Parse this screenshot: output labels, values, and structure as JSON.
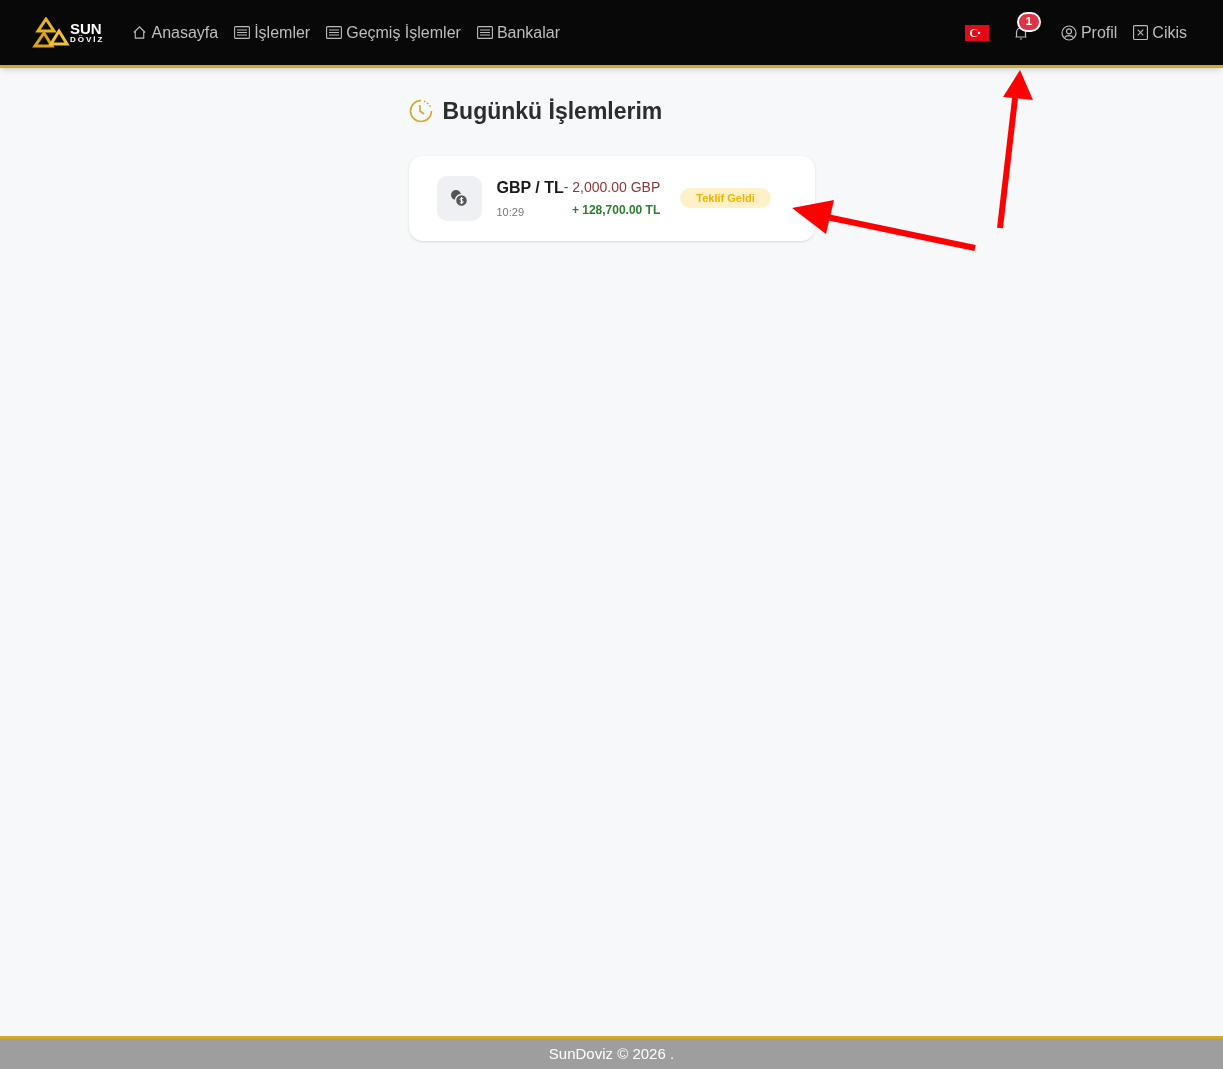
{
  "logo": {
    "word": "SUN",
    "subword": "DÖVİZ"
  },
  "nav": [
    {
      "label": "Anasayfa",
      "kind": "home"
    },
    {
      "label": "İşlemler",
      "kind": "list"
    },
    {
      "label": "Geçmiş İşlemler",
      "kind": "list"
    },
    {
      "label": "Bankalar",
      "kind": "list"
    }
  ],
  "notifications": {
    "count": "1"
  },
  "user_menu": [
    {
      "label": "Profil",
      "kind": "user"
    },
    {
      "label": "Cikis",
      "kind": "exit"
    }
  ],
  "page_title": "Bugünkü İşlemlerim",
  "transactions": [
    {
      "pair": "GBP / TL",
      "time": "10:29",
      "debit": "- 2,000.00 GBP",
      "credit": "+ 128,700.00 TL",
      "status": "Teklif Geldi"
    }
  ],
  "footer": "SunDoviz © 2026 ."
}
